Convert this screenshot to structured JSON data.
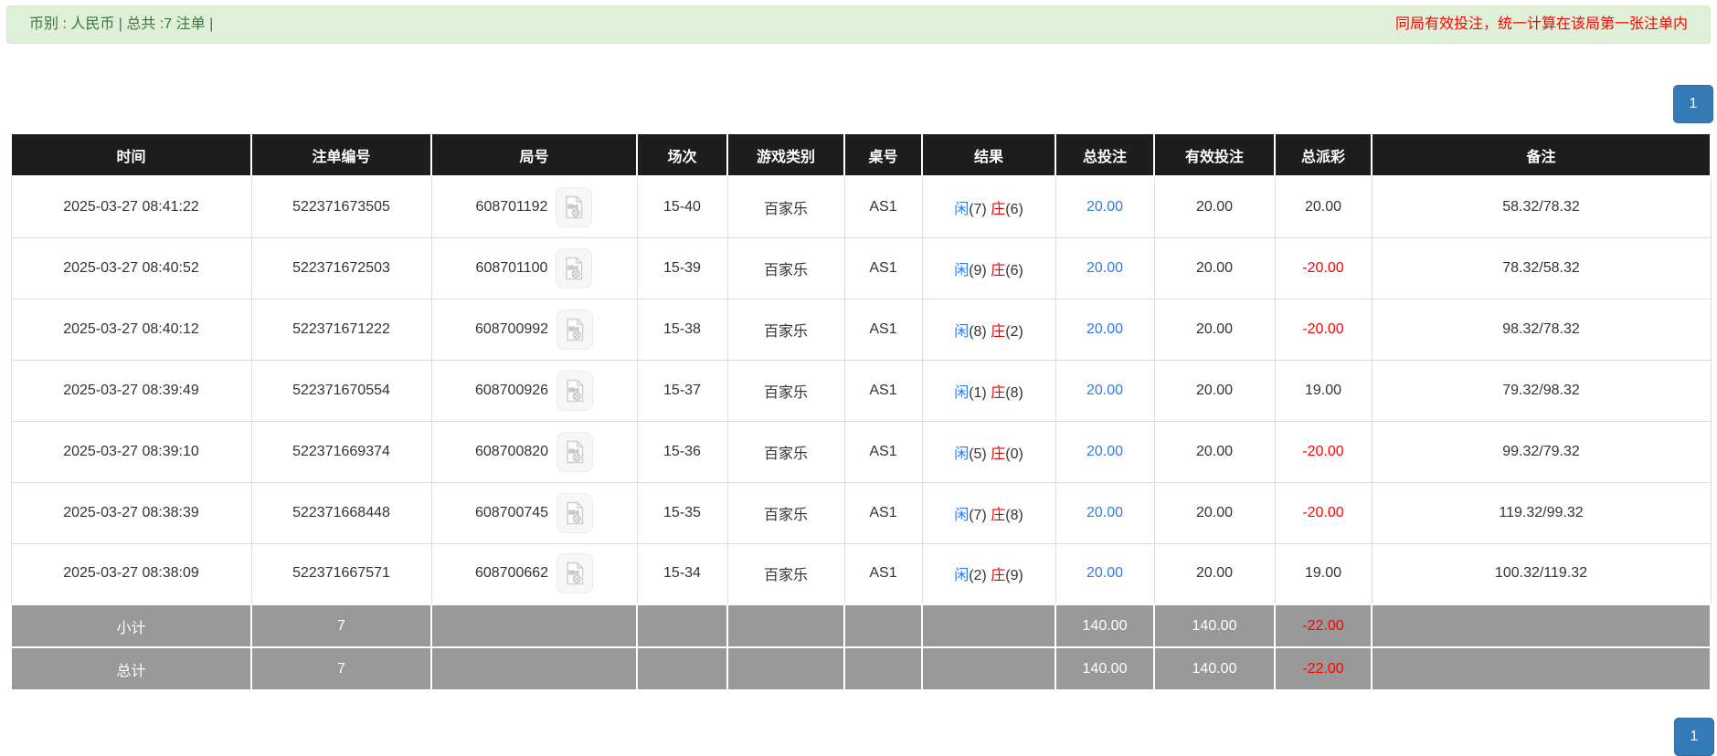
{
  "notice_bar": {
    "left_text": "币别 : 人民币 | 总共 :7 注单 |",
    "right_text": "同局有效投注，统一计算在该局第一张注单内"
  },
  "pagination": {
    "page": "1"
  },
  "table": {
    "columns": [
      "时间",
      "注单编号",
      "局号",
      "场次",
      "游戏类别",
      "桌号",
      "结果",
      "总投注",
      "有效投注",
      "总派彩",
      "备注"
    ],
    "rows": [
      {
        "time": "2025-03-27 08:41:22",
        "bet_no": "522371673505",
        "game_no": "608701192",
        "session": "15-40",
        "game_type": "百家乐",
        "table_no": "AS1",
        "result": {
          "player_label": "闲",
          "player_pts": "(7)",
          "banker_label": "庄",
          "banker_pts": "(6)"
        },
        "total_bet": "20.00",
        "valid_bet": "20.00",
        "payout": "20.00",
        "remark": "58.32/78.32"
      },
      {
        "time": "2025-03-27 08:40:52",
        "bet_no": "522371672503",
        "game_no": "608701100",
        "session": "15-39",
        "game_type": "百家乐",
        "table_no": "AS1",
        "result": {
          "player_label": "闲",
          "player_pts": "(9)",
          "banker_label": "庄",
          "banker_pts": "(6)"
        },
        "total_bet": "20.00",
        "valid_bet": "20.00",
        "payout": "-20.00",
        "remark": "78.32/58.32"
      },
      {
        "time": "2025-03-27 08:40:12",
        "bet_no": "522371671222",
        "game_no": "608700992",
        "session": "15-38",
        "game_type": "百家乐",
        "table_no": "AS1",
        "result": {
          "player_label": "闲",
          "player_pts": "(8)",
          "banker_label": "庄",
          "banker_pts": "(2)"
        },
        "total_bet": "20.00",
        "valid_bet": "20.00",
        "payout": "-20.00",
        "remark": "98.32/78.32"
      },
      {
        "time": "2025-03-27 08:39:49",
        "bet_no": "522371670554",
        "game_no": "608700926",
        "session": "15-37",
        "game_type": "百家乐",
        "table_no": "AS1",
        "result": {
          "player_label": "闲",
          "player_pts": "(1)",
          "banker_label": "庄",
          "banker_pts": "(8)"
        },
        "total_bet": "20.00",
        "valid_bet": "20.00",
        "payout": "19.00",
        "remark": "79.32/98.32"
      },
      {
        "time": "2025-03-27 08:39:10",
        "bet_no": "522371669374",
        "game_no": "608700820",
        "session": "15-36",
        "game_type": "百家乐",
        "table_no": "AS1",
        "result": {
          "player_label": "闲",
          "player_pts": "(5)",
          "banker_label": "庄",
          "banker_pts": "(0)"
        },
        "total_bet": "20.00",
        "valid_bet": "20.00",
        "payout": "-20.00",
        "remark": "99.32/79.32"
      },
      {
        "time": "2025-03-27 08:38:39",
        "bet_no": "522371668448",
        "game_no": "608700745",
        "session": "15-35",
        "game_type": "百家乐",
        "table_no": "AS1",
        "result": {
          "player_label": "闲",
          "player_pts": "(7)",
          "banker_label": "庄",
          "banker_pts": "(8)"
        },
        "total_bet": "20.00",
        "valid_bet": "20.00",
        "payout": "-20.00",
        "remark": "119.32/99.32"
      },
      {
        "time": "2025-03-27 08:38:09",
        "bet_no": "522371667571",
        "game_no": "608700662",
        "session": "15-34",
        "game_type": "百家乐",
        "table_no": "AS1",
        "result": {
          "player_label": "闲",
          "player_pts": "(2)",
          "banker_label": "庄",
          "banker_pts": "(9)"
        },
        "total_bet": "20.00",
        "valid_bet": "20.00",
        "payout": "19.00",
        "remark": "100.32/119.32"
      }
    ],
    "summary": [
      {
        "label": "小计",
        "count": "7",
        "total_bet": "140.00",
        "valid_bet": "140.00",
        "payout": "-22.00",
        "remark": ""
      },
      {
        "label": "总计",
        "count": "7",
        "total_bet": "140.00",
        "valid_bet": "140.00",
        "payout": "-22.00",
        "remark": ""
      }
    ]
  },
  "icons": {
    "video_icon_name": "video-file-icon"
  },
  "colors": {
    "notice_bg": "#dff0d8",
    "notice_border": "#d6e9c6",
    "notice_text": "#3c763d",
    "alert_red": "#ff0000",
    "header_bg": "#1d1d1d",
    "link_blue": "#2b7af0",
    "banker_red": "#e60000",
    "summary_bg": "#999999",
    "page_blue": "#337ab7",
    "page_blue_border": "#2e6da4"
  }
}
